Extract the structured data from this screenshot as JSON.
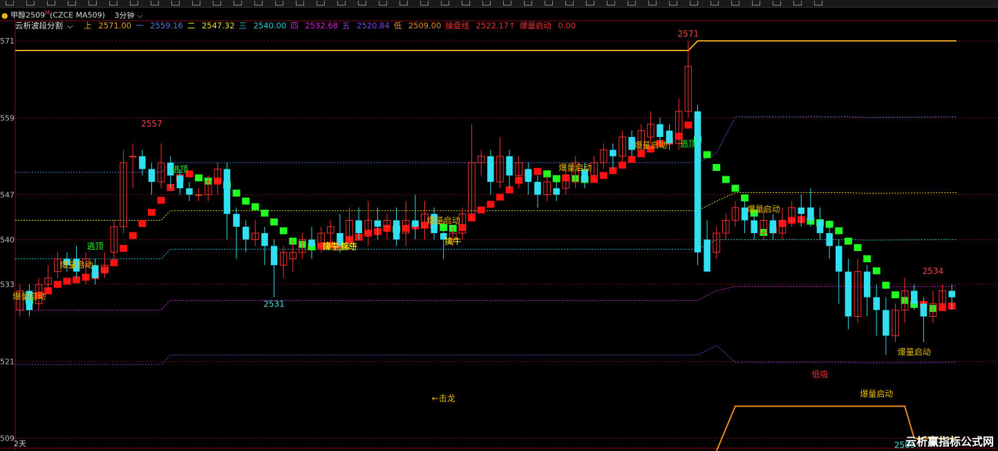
{
  "header": {
    "symbol_name": "甲醇2509",
    "symbol_sup": "M",
    "symbol_code": "(CZCE MA509)",
    "period": "3分钟",
    "period_dropdown_icon": "chevron-down-icon"
  },
  "legend": {
    "indicator": "云析波段分割",
    "items": [
      {
        "label": "上",
        "value": "2571.00",
        "color": "#e8a020"
      },
      {
        "label": "一",
        "value": "2559.16",
        "color": "#4a7bd8"
      },
      {
        "label": "二",
        "value": "2547.32",
        "color": "#e8e020"
      },
      {
        "label": "三",
        "value": "2540.00",
        "color": "#20c8d8"
      },
      {
        "label": "四",
        "value": "2532.68",
        "color": "#d020d0"
      },
      {
        "label": "五",
        "value": "2520.84",
        "color": "#8040e0"
      },
      {
        "label": "低",
        "value": "2509.00",
        "color": "#e88a20"
      },
      {
        "label": "操盘线",
        "value": "2522.17↑",
        "color": "#e83030"
      },
      {
        "label": "爆量启动",
        "value": "0.00",
        "color": "#e83030"
      }
    ]
  },
  "footer": {
    "days_label": "2天",
    "watermark": "云析赢指标公式网"
  },
  "colors": {
    "up_body": "#ff3030",
    "down_body": "#30e0f0",
    "ma_up": "#ff1010",
    "ma_down": "#20ff20",
    "grid": "#7a1010",
    "axis": "#8a1010"
  },
  "chart_data": {
    "type": "candlestick",
    "y_ticks": [
      2509,
      2521,
      2533,
      2540,
      2547,
      2559,
      2571
    ],
    "y_tick_labels": [
      "509",
      "521",
      "533",
      "540",
      "547",
      "559",
      "571"
    ],
    "ylim": [
      2508.3,
      2572.2
    ],
    "bars": 100,
    "candles": [
      [
        2529,
        2532,
        2528,
        2533
      ],
      [
        2532,
        2529,
        2528,
        2533
      ],
      [
        2530,
        2533,
        2529,
        2534
      ],
      [
        2533,
        2534,
        2532,
        2536
      ],
      [
        2535,
        2537,
        2534,
        2538
      ],
      [
        2537,
        2536,
        2535,
        2538
      ],
      [
        2537,
        2535,
        2534,
        2539
      ],
      [
        2536,
        2537,
        2533,
        2538
      ],
      [
        2536,
        2534,
        2533,
        2537
      ],
      [
        2535,
        2536,
        2534,
        2538
      ],
      [
        2538,
        2542,
        2537,
        2543
      ],
      [
        2542,
        2552,
        2541,
        2554
      ],
      [
        2553,
        2553,
        2548,
        2555
      ],
      [
        2553,
        2551,
        2550,
        2554
      ],
      [
        2551,
        2549,
        2547,
        2552
      ],
      [
        2549,
        2552,
        2548,
        2555
      ],
      [
        2552,
        2550,
        2548,
        2553
      ],
      [
        2550,
        2548,
        2547,
        2551
      ],
      [
        2548,
        2547,
        2546,
        2549
      ],
      [
        2547,
        2547,
        2546,
        2548
      ],
      [
        2547,
        2549,
        2546,
        2550
      ],
      [
        2549,
        2551,
        2547,
        2552
      ],
      [
        2551,
        2544,
        2540,
        2552
      ],
      [
        2544,
        2542,
        2537,
        2545
      ],
      [
        2542,
        2540,
        2538,
        2543
      ],
      [
        2540,
        2541,
        2539,
        2543
      ],
      [
        2541,
        2539,
        2536,
        2542
      ],
      [
        2539,
        2536,
        2531,
        2540
      ],
      [
        2536,
        2538,
        2534,
        2539
      ],
      [
        2537,
        2538,
        2535,
        2540
      ],
      [
        2538,
        2540,
        2537,
        2541
      ],
      [
        2540,
        2539,
        2537,
        2542
      ],
      [
        2539,
        2541,
        2538,
        2542
      ],
      [
        2541,
        2542,
        2539,
        2543
      ],
      [
        2541,
        2539,
        2538,
        2544
      ],
      [
        2540,
        2543,
        2539,
        2545
      ],
      [
        2543,
        2541,
        2540,
        2545
      ],
      [
        2541,
        2543,
        2539,
        2546
      ],
      [
        2543,
        2542,
        2540,
        2545
      ],
      [
        2542,
        2543,
        2540,
        2544
      ],
      [
        2543,
        2540,
        2539,
        2545
      ],
      [
        2541,
        2543,
        2539,
        2546
      ],
      [
        2543,
        2542,
        2540,
        2547
      ],
      [
        2542,
        2544,
        2540,
        2546
      ],
      [
        2544,
        2541,
        2540,
        2545
      ],
      [
        2541,
        2540,
        2537,
        2543
      ],
      [
        2540,
        2541,
        2539,
        2542
      ],
      [
        2541,
        2544,
        2540,
        2545
      ],
      [
        2544,
        2552,
        2543,
        2558
      ],
      [
        2552,
        2553,
        2550,
        2554
      ],
      [
        2553,
        2549,
        2547,
        2554
      ],
      [
        2549,
        2553,
        2548,
        2556
      ],
      [
        2553,
        2550,
        2548,
        2554
      ],
      [
        2550,
        2552,
        2548,
        2553
      ],
      [
        2551,
        2549,
        2547,
        2552
      ],
      [
        2549,
        2547,
        2545,
        2550
      ],
      [
        2547,
        2549,
        2546,
        2550
      ],
      [
        2548,
        2547,
        2546,
        2549
      ],
      [
        2548,
        2550,
        2547,
        2551
      ],
      [
        2549,
        2552,
        2548,
        2553
      ],
      [
        2551,
        2549,
        2548,
        2552
      ],
      [
        2550,
        2552,
        2549,
        2553
      ],
      [
        2552,
        2554,
        2551,
        2555
      ],
      [
        2554,
        2553,
        2551,
        2555
      ],
      [
        2553,
        2556,
        2552,
        2557
      ],
      [
        2556,
        2554,
        2553,
        2557
      ],
      [
        2554,
        2557,
        2553,
        2558
      ],
      [
        2556,
        2558,
        2555,
        2560
      ],
      [
        2558,
        2556,
        2555,
        2559
      ],
      [
        2557,
        2555,
        2554,
        2558
      ],
      [
        2555,
        2560,
        2554,
        2562
      ],
      [
        2560,
        2567,
        2559,
        2571
      ],
      [
        2560,
        2538,
        2536,
        2561
      ],
      [
        2540,
        2535,
        2535,
        2543
      ],
      [
        2538,
        2541,
        2537,
        2542
      ],
      [
        2541,
        2543,
        2540,
        2544
      ],
      [
        2543,
        2545,
        2542,
        2546
      ],
      [
        2545,
        2543,
        2541,
        2546
      ],
      [
        2543,
        2541,
        2540,
        2544
      ],
      [
        2541,
        2543,
        2540,
        2545
      ],
      [
        2543,
        2541,
        2540,
        2544
      ],
      [
        2541,
        2543,
        2540,
        2545
      ],
      [
        2543,
        2545,
        2542,
        2546
      ],
      [
        2545,
        2544,
        2542,
        2547
      ],
      [
        2545,
        2543,
        2542,
        2548
      ],
      [
        2543,
        2541,
        2540,
        2545
      ],
      [
        2541,
        2539,
        2537,
        2543
      ],
      [
        2539,
        2535,
        2530,
        2540
      ],
      [
        2535,
        2528,
        2526,
        2537
      ],
      [
        2528,
        2535,
        2527,
        2537
      ],
      [
        2535,
        2531,
        2528,
        2536
      ],
      [
        2531,
        2529,
        2525,
        2533
      ],
      [
        2529,
        2525,
        2522,
        2531
      ],
      [
        2525,
        2529,
        2524,
        2530
      ],
      [
        2529,
        2532,
        2527,
        2534
      ],
      [
        2532,
        2530,
        2529,
        2533
      ],
      [
        2530,
        2528,
        2524,
        2531
      ],
      [
        2528,
        2530,
        2527,
        2532
      ],
      [
        2530,
        2532,
        2529,
        2533
      ],
      [
        2532,
        2531,
        2529,
        2533
      ]
    ],
    "support_resistance": [
      {
        "name": "上",
        "value": 2571.0
      },
      {
        "name": "一",
        "value": 2559.16
      },
      {
        "name": "二",
        "value": 2547.32
      },
      {
        "name": "三",
        "value": 2540.0
      },
      {
        "name": "四",
        "value": 2532.68
      },
      {
        "name": "五",
        "value": 2520.84
      },
      {
        "name": "低",
        "value": 2509.0
      }
    ],
    "annotations": [
      {
        "text": "2557",
        "bar": 14,
        "value": 2557,
        "color": "#ff4040",
        "pos": "above"
      },
      {
        "text": "2531",
        "bar": 27,
        "value": 2531,
        "color": "#40e0e0",
        "pos": "below"
      },
      {
        "text": "2571",
        "bar": 71,
        "value": 2571,
        "color": "#ff4040",
        "pos": "above"
      },
      {
        "text": "2509",
        "bar": 94,
        "value": 2509,
        "color": "#40e0e0",
        "pos": "below"
      },
      {
        "text": "2534",
        "bar": 97,
        "value": 2534,
        "color": "#ff4040",
        "pos": "above"
      },
      {
        "text": "逃顶",
        "bar": 8,
        "value": 2538.5,
        "color": "#20ff20"
      },
      {
        "text": "逃顶",
        "bar": 17,
        "value": 2550.5,
        "color": "#20ff20"
      },
      {
        "text": "逃顶",
        "bar": 71,
        "value": 2554.5,
        "color": "#20ff20"
      },
      {
        "text": "爆量启动",
        "bar": 1,
        "value": 2530.7,
        "color": "#e8b800"
      },
      {
        "text": "爆量启动",
        "bar": 6,
        "value": 2535.6,
        "color": "#e8b800"
      },
      {
        "text": "爆量启动",
        "bar": 34,
        "value": 2538.4,
        "color": "#e8b800"
      },
      {
        "text": "爆量启动",
        "bar": 45,
        "value": 2542.5,
        "color": "#e8b800"
      },
      {
        "text": "爆量启动",
        "bar": 59,
        "value": 2550.8,
        "color": "#e8b800"
      },
      {
        "text": "爆量启动",
        "bar": 67,
        "value": 2554.3,
        "color": "#e8b800"
      },
      {
        "text": "爆量启动",
        "bar": 79,
        "value": 2544.3,
        "color": "#e8b800"
      },
      {
        "text": "爆量启动",
        "bar": 91,
        "value": 2515.5,
        "color": "#e8b800"
      },
      {
        "text": "爆量启动",
        "bar": 95,
        "value": 2522.0,
        "color": "#e8b800"
      },
      {
        "text": "擒牛",
        "bar": 33,
        "value": 2538.5,
        "color": "#ffff00"
      },
      {
        "text": "擒牛",
        "bar": 35,
        "value": 2538.5,
        "color": "#ffff00"
      },
      {
        "text": "擒牛",
        "bar": 46,
        "value": 2539.3,
        "color": "#ffff00"
      },
      {
        "text": "←击龙",
        "bar": 45,
        "value": 2514.8,
        "color": "#e8b800"
      },
      {
        "text": "低吸",
        "bar": 85,
        "value": 2518.5,
        "color": "#ff3030"
      }
    ]
  }
}
